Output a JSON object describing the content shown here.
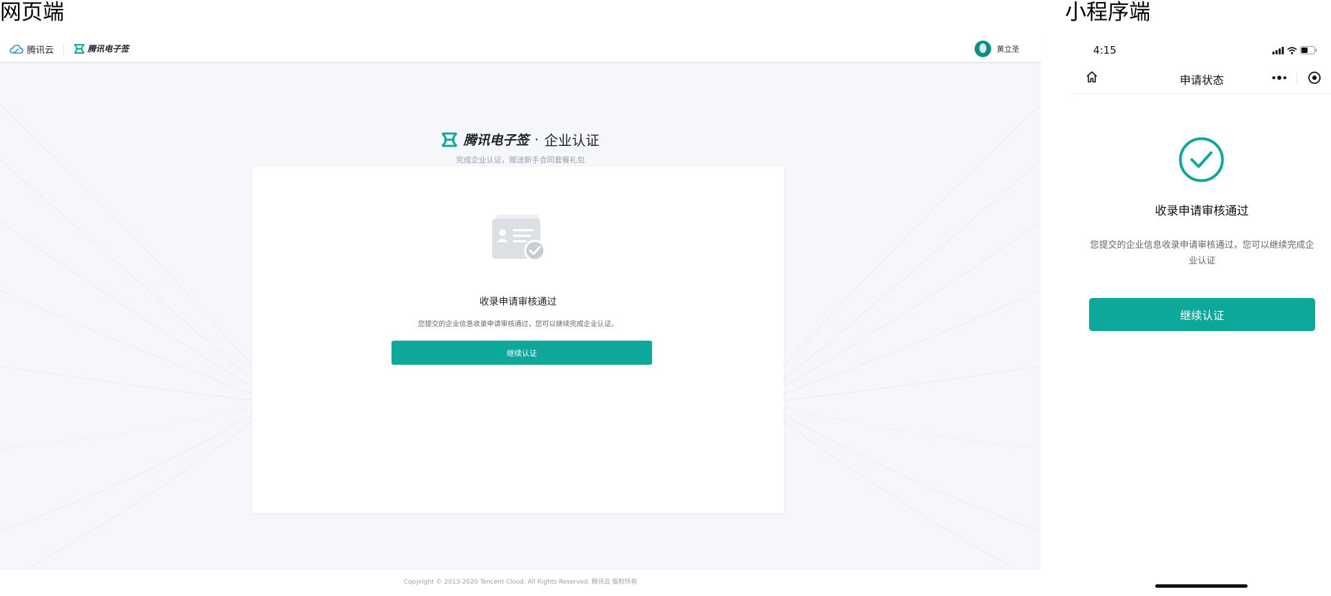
{
  "labels": {
    "web": "网页端",
    "mini_program": "小程序端"
  },
  "web": {
    "header": {
      "cloud_brand": "腾讯云",
      "esign_brand": "腾讯电子签",
      "user_name": "黄立圣"
    },
    "page": {
      "brand": "腾讯电子签",
      "separator": "·",
      "title": "企业认证",
      "subtitle": "完成企业认证，赠送新手合同套餐礼包"
    },
    "card": {
      "icon": "id-card-check-icon",
      "title": "收录申请审核通过",
      "description": "您提交的企业信息收录申请审核通过，您可以继续完成企业认证。",
      "button": "继续认证"
    },
    "footer": "Copyright © 2013-2020 Tencent Cloud. All Rights Reserved. 腾讯云 版权所有"
  },
  "mini_program": {
    "status_bar": {
      "time": "4:15"
    },
    "nav": {
      "title": "申请状态"
    },
    "result": {
      "icon": "check-circle-icon",
      "title": "收录申请审核通过",
      "description": "您提交的企业信息收录申请审核通过，您可以继续完成企业认证",
      "button": "继续认证"
    }
  },
  "colors": {
    "accent": "#0ca89a",
    "page_bg": "#f6f7fa"
  }
}
